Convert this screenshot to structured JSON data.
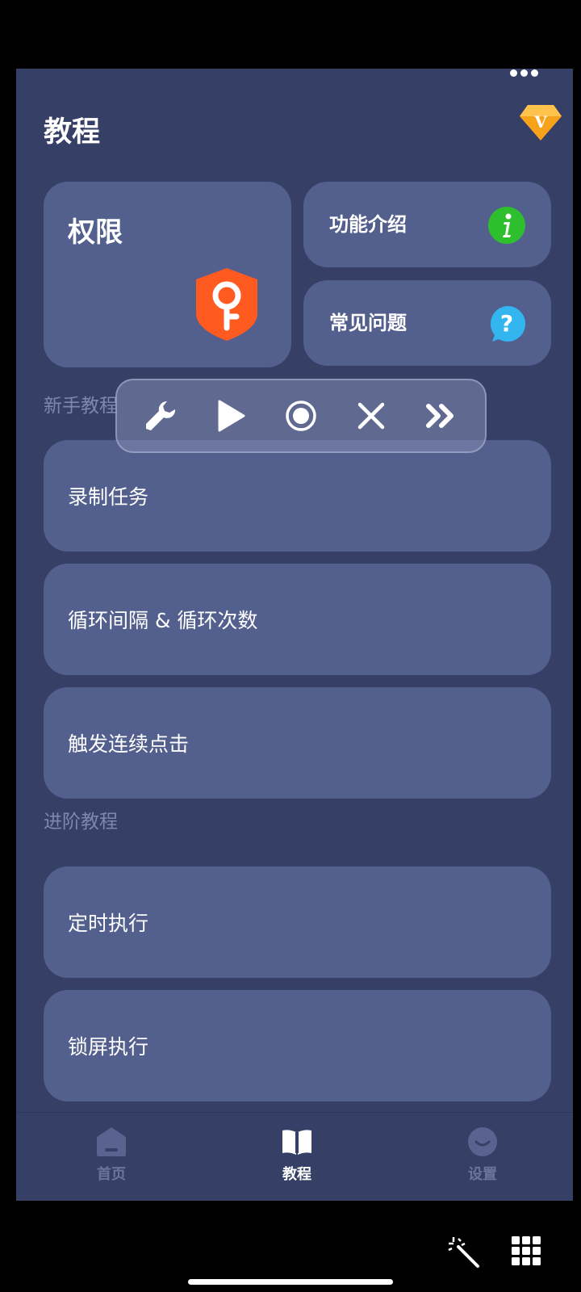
{
  "page": {
    "title": "教程"
  },
  "cards": {
    "permission": "权限",
    "features": "功能介绍",
    "faq": "常见问题"
  },
  "sections": {
    "beginner": "新手教程",
    "advanced": "进阶教程"
  },
  "beginner_items": [
    "录制任务",
    "循环间隔 & 循环次数",
    "触发连续点击"
  ],
  "advanced_items": [
    "定时执行",
    "锁屏执行"
  ],
  "nav": {
    "home": "首页",
    "tutorial": "教程",
    "settings": "设置"
  },
  "icons": {
    "vip": "vip-diamond-icon",
    "permission": "key-shield-icon",
    "features": "info-icon",
    "faq": "question-icon",
    "toolbar": [
      "wrench-icon",
      "play-icon",
      "record-icon",
      "close-icon",
      "fast-forward-icon"
    ]
  },
  "colors": {
    "background": "#363f66",
    "card": "#53608e",
    "accent_orange": "#ff5a1f",
    "info_green": "#2dbf2d",
    "faq_blue": "#33b6ef",
    "vip_gold": "#f7a21b",
    "nav_active": "#ffffff",
    "nav_inactive": "#7f87ad"
  }
}
